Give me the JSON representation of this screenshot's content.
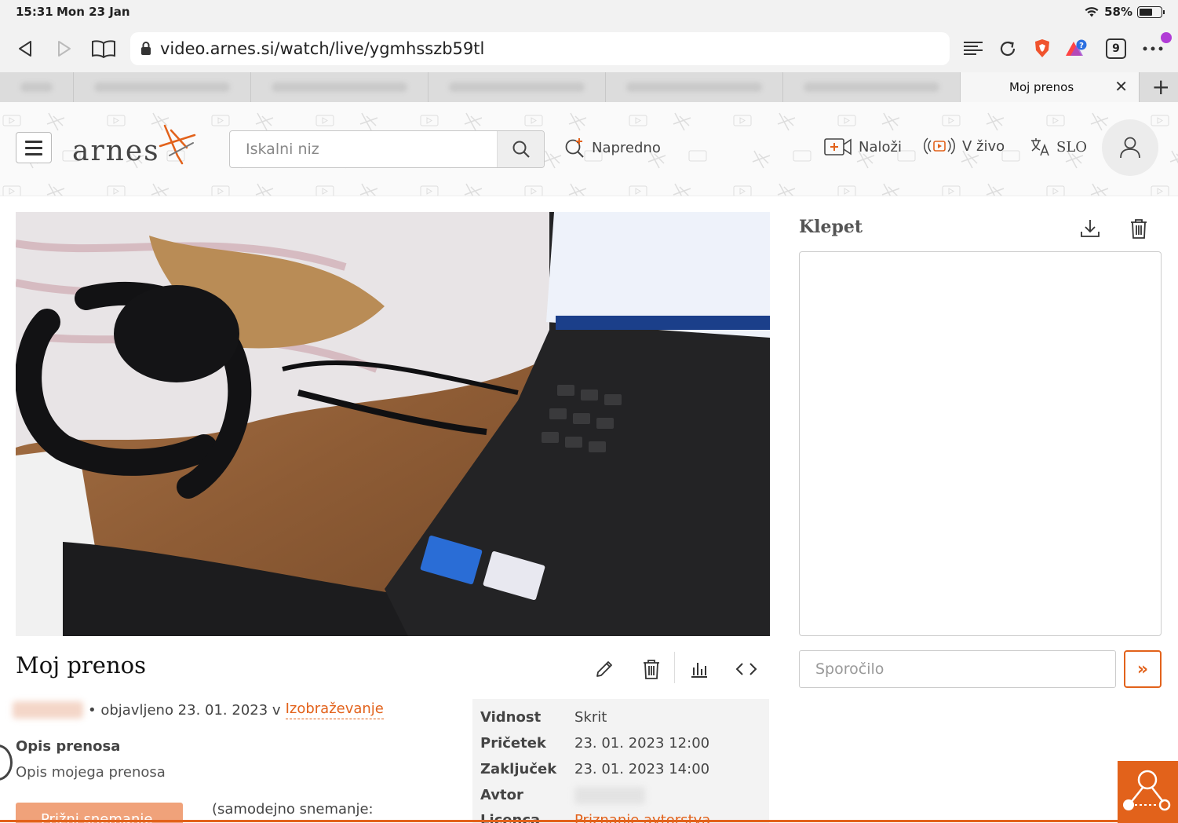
{
  "status_bar": {
    "time": "15:31",
    "date": "Mon 23 Jan",
    "battery": "58%",
    "battery_level": 0.58
  },
  "browser": {
    "url": "video.arnes.si/watch/live/ygmhsszb59tl",
    "tab_count": "9",
    "active_tab_title": "Moj prenos",
    "icons": [
      "back-icon",
      "forward-icon",
      "bookmarks-icon",
      "lock-icon",
      "reader-icon",
      "reload-icon",
      "brave-shield-icon",
      "rewards-icon",
      "more-icon",
      "close-icon",
      "plus-icon"
    ]
  },
  "header": {
    "logo_text": "arnes",
    "search_placeholder": "Iskalni niz",
    "advanced": "Napredno",
    "upload": "Naloži",
    "live": "V živo",
    "language": "SLO"
  },
  "video": {
    "title": "Moj prenos",
    "published": "• objavljeno 23. 01. 2023 v",
    "category": "Izobraževanje",
    "description_heading": "Opis prenosa",
    "description": "Opis mojega prenosa",
    "record_button": "Prižni snemanje",
    "auto_record": "(samodejno snemanje:"
  },
  "info": {
    "rows": [
      {
        "key": "Vidnost",
        "value": "Skrit"
      },
      {
        "key": "Pričetek",
        "value": "23. 01. 2023 12:00"
      },
      {
        "key": "Zaključek",
        "value": "23. 01. 2023 14:00"
      },
      {
        "key": "Avtor",
        "value": ""
      },
      {
        "key": "Licenca",
        "value": "Priznanje avtorstva"
      }
    ]
  },
  "chat": {
    "title": "Klepet",
    "message_placeholder": "Sporočilo",
    "send_label": "»"
  },
  "colors": {
    "accent": "#e2621b",
    "toolbar": "#f2f2f2"
  }
}
